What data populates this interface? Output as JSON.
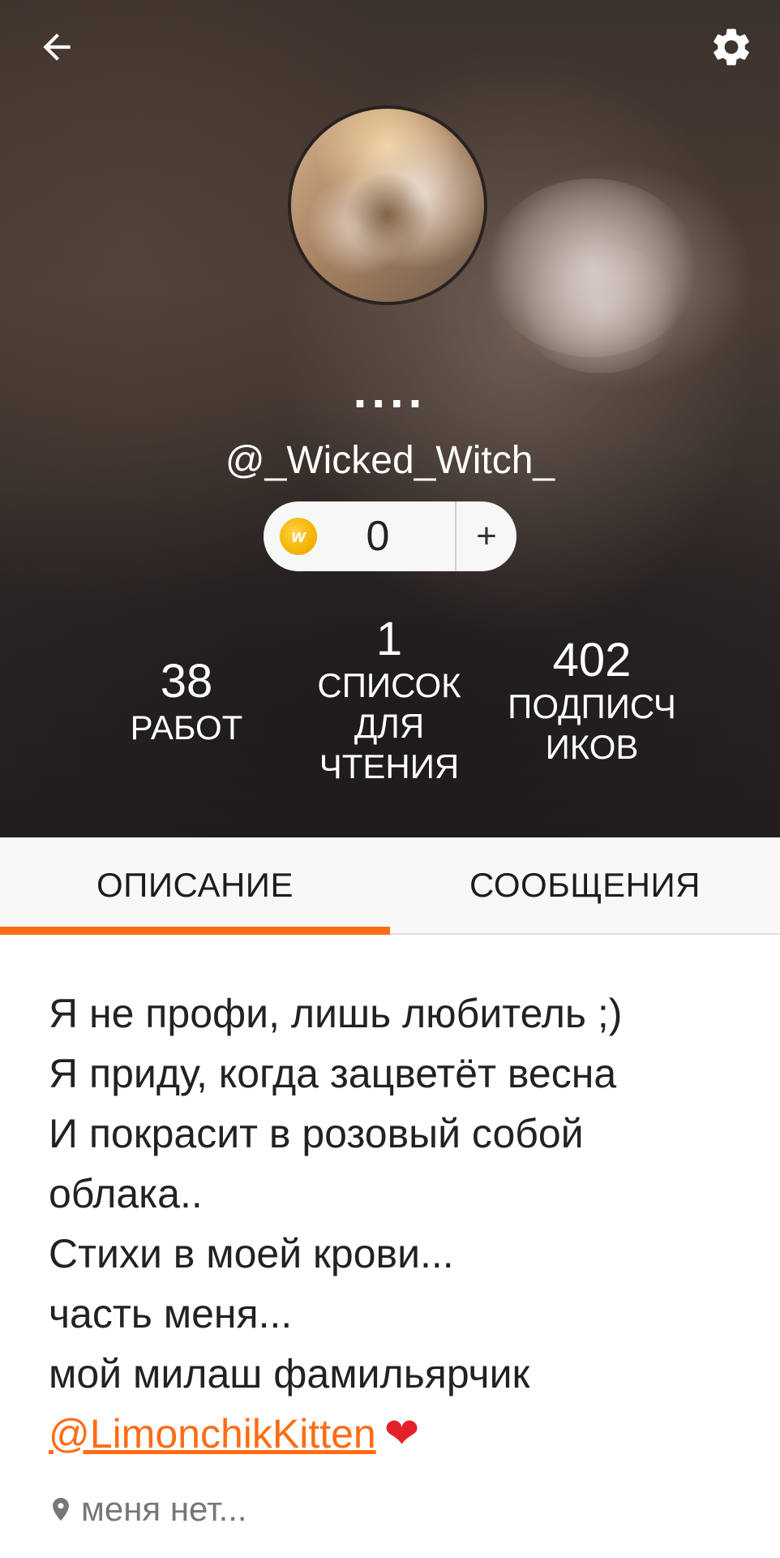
{
  "header": {
    "display_name": "....",
    "username": "@_Wicked_Witch_",
    "coins": {
      "count": "0",
      "plus": "+"
    }
  },
  "stats": [
    {
      "number": "38",
      "label_lines": [
        "РАБОТ"
      ]
    },
    {
      "number": "1",
      "label_lines": [
        "СПИСОК",
        "ДЛЯ",
        "ЧТЕНИЯ"
      ]
    },
    {
      "number": "402",
      "label_lines": [
        "ПОДПИСЧ",
        "ИКОВ"
      ]
    }
  ],
  "tabs": {
    "about": "ОПИСАНИЕ",
    "messages": "СООБЩЕНИЯ"
  },
  "description": {
    "lines": [
      "Я не профи, лишь любитель ;)",
      "Я приду, когда зацветёт весна",
      "И покрасит в розовый собой",
      "облака..",
      "Стихи в моей крови...",
      "часть меня...",
      "мой милаш фамильярчик"
    ],
    "mention": "@LimonchikKitten",
    "heart": "❤"
  },
  "location": "меня нет...",
  "colors": {
    "accent": "#ff6c15",
    "tab_bg": "#f8f8f8",
    "coin": "#f4b400",
    "heart": "#e3212a"
  },
  "icons": [
    "back-arrow-icon",
    "settings-gear-icon",
    "coin-icon",
    "location-pin-icon",
    "heart-icon"
  ]
}
